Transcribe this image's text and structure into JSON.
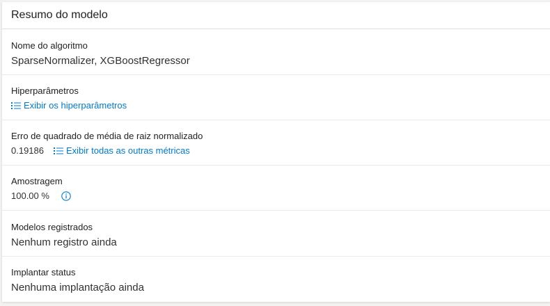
{
  "card": {
    "title": "Resumo do modelo"
  },
  "algorithm": {
    "label": "Nome do algoritmo",
    "value": "SparseNormalizer, XGBoostRegressor"
  },
  "hyperparameters": {
    "label": "Hiperparâmetros",
    "link": "Exibir os hiperparâmetros"
  },
  "metric": {
    "label": "Erro de quadrado de média de raiz normalizado",
    "value": "0.19186",
    "link": "Exibir todas as outras métricas"
  },
  "sampling": {
    "label": "Amostragem",
    "value": "100.00 %"
  },
  "registered": {
    "label": "Modelos registrados",
    "value": "Nenhum registro ainda"
  },
  "deploy": {
    "label": "Implantar status",
    "value": "Nenhuma implantação ainda"
  },
  "colors": {
    "link": "#0078d4",
    "text": "#323130",
    "divider": "#edebe9"
  }
}
